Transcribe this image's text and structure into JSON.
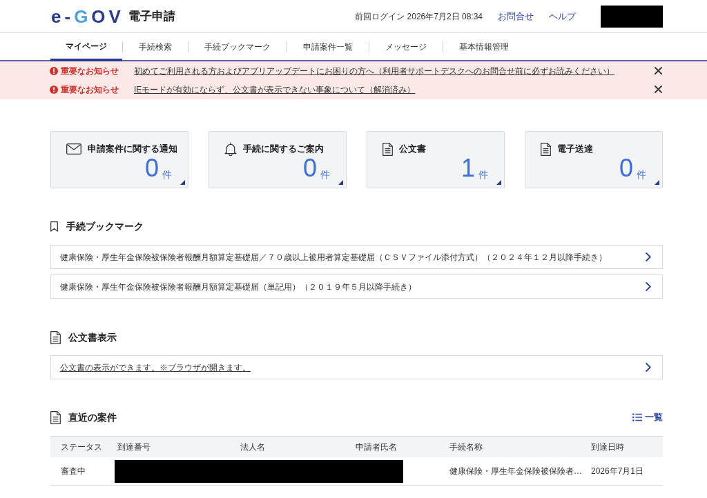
{
  "header": {
    "logo": "e-GOV",
    "service_name": "電子申請",
    "last_login": "前回ログイン 2026年7月2日 08:34",
    "links": [
      "お問合せ",
      "ヘルプ"
    ]
  },
  "nav": {
    "tabs": [
      {
        "label": "マイページ",
        "selected": true
      },
      {
        "label": "手続検索",
        "selected": false
      },
      {
        "label": "手続ブックマーク",
        "selected": false
      },
      {
        "label": "申請案件一覧",
        "selected": false
      },
      {
        "label": "メッセージ",
        "selected": false
      },
      {
        "label": "基本情報管理",
        "selected": false
      }
    ]
  },
  "notices": [
    {
      "label": "重要なお知らせ",
      "text": "初めてご利用される方およびアプリアップデートにお困りの方へ（利用者サポートデスクへのお問合せ前に必ずお読みください）"
    },
    {
      "label": "重要なお知らせ",
      "text": "IEモードが有効にならず、公文書が表示できない事象について（解消済み）"
    }
  ],
  "summary_cards": [
    {
      "title": "申請案件に関する通知",
      "count": "0",
      "unit": "件"
    },
    {
      "title": "手続に関するご案内",
      "count": "0",
      "unit": "件"
    },
    {
      "title": "公文書",
      "count": "1",
      "unit": "件"
    },
    {
      "title": "電子送達",
      "count": "0",
      "unit": "件"
    }
  ],
  "bookmarks": {
    "title": "手続ブックマーク",
    "items": [
      "健康保険・厚生年金保険被保険者報酬月額算定基礎届／７０歳以上被用者算定基礎届（ＣＳＶファイル添付方式）（２０２４年１２月以降手続き）",
      "健康保険・厚生年金保険被保険者報酬月額算定基礎届（単記用）（２０１９年５月以降手続き）"
    ]
  },
  "official_documents": {
    "title": "公文書表示",
    "items": [
      "公文書の表示ができます。※ブラウザが開きます。"
    ]
  },
  "recent_cases": {
    "title": "直近の案件",
    "list_link": "一覧",
    "columns": [
      "ステータス",
      "到達番号",
      "法人名",
      "申請者氏名",
      "手続名称",
      "到達日時"
    ],
    "rows": [
      {
        "status": "審査中",
        "procedure_name": "健康保険・厚生年金保険被保険者…",
        "arrival_datetime": "2026年7月1日"
      }
    ]
  }
}
